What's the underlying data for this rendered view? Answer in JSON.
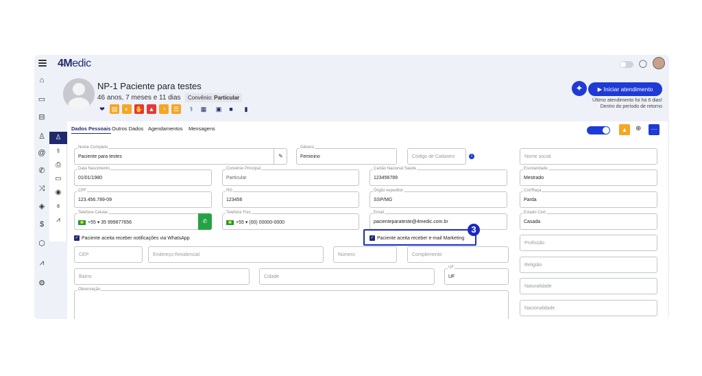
{
  "app": {
    "logo_4": "4",
    "logo_m": "M",
    "logo_rest": "edic"
  },
  "patient": {
    "name": "NP-1 Paciente para testes",
    "age": "46 anos, 7 meses e 11 dias",
    "convenio_label": "Convênio:",
    "convenio_value": "Particular"
  },
  "header": {
    "start_button": "Iniciar atendimento",
    "last_attendance": "Último atendimento foi há 6 dias!",
    "return_period": "Dentro do período de retorno"
  },
  "tabs": [
    {
      "label": "Dados Pessoais"
    },
    {
      "label": "Outros Dados"
    },
    {
      "label": "Agendamentos"
    },
    {
      "label": "Mensagens"
    }
  ],
  "form": {
    "nome_completo": {
      "label": "Nome Completo",
      "value": "Paciente para testes"
    },
    "genero": {
      "label": "Gênero",
      "value": "Feminino"
    },
    "codigo_cadastro": {
      "placeholder": "Código de Cadastro"
    },
    "nome_social": {
      "placeholder": "Nome social"
    },
    "data_nascimento": {
      "label": "Data Nascimento",
      "value": "01/01/1980"
    },
    "convenio_principal": {
      "label": "Convênio Principal",
      "value": "Particular"
    },
    "cartao_sus": {
      "label": "Cartão Nacional Saúde",
      "value": "123456789"
    },
    "escolaridade": {
      "label": "Escolaridade",
      "value": "Mestrado"
    },
    "cpf": {
      "label": "CPF",
      "value": "123.456.789-09"
    },
    "rg": {
      "label": "RG",
      "value": "123456"
    },
    "orgao_expeditor": {
      "label": "Órgão expeditor",
      "value": "SSP/MG"
    },
    "cor_raca": {
      "label": "Cor/Raça",
      "value": "Parda"
    },
    "telefone_celular": {
      "label": "Telefone Celular",
      "value": "+55 ▾  35 999877656"
    },
    "telefone_fixo": {
      "label": "Telefone Fixo",
      "value": "+55 ▾  (00) 00000-0000"
    },
    "email": {
      "label": "Email",
      "value": "pacienteparateste@4medic.com.br"
    },
    "estado_civil": {
      "label": "Estado Civil",
      "value": "Casada"
    },
    "whatsapp_check": "Paciente aceita receber notificações via WhatsApp",
    "email_marketing_check": "Paciente aceita receber e-mail Marketing",
    "profissao": {
      "placeholder": "Profissão"
    },
    "cep": {
      "placeholder": "CEP"
    },
    "endereco": {
      "placeholder": "Endereço Residencial"
    },
    "numero": {
      "placeholder": "Número"
    },
    "complemento": {
      "placeholder": "Complemento"
    },
    "religiao": {
      "placeholder": "Religião"
    },
    "bairro": {
      "placeholder": "Bairro"
    },
    "cidade": {
      "placeholder": "Cidade"
    },
    "uf": {
      "label": "UF",
      "value": "UF"
    },
    "naturalidade": {
      "placeholder": "Naturalidade"
    },
    "observacao": {
      "label": "Observação"
    },
    "nacionalidade": {
      "placeholder": "Nacionalidade"
    }
  },
  "annotation": {
    "step_number": "3"
  },
  "colors": {
    "primary": "#1f2a6e",
    "accent": "#1f3bd6",
    "whatsapp": "#25a244",
    "warning": "#f5a623",
    "danger": "#e53935"
  }
}
